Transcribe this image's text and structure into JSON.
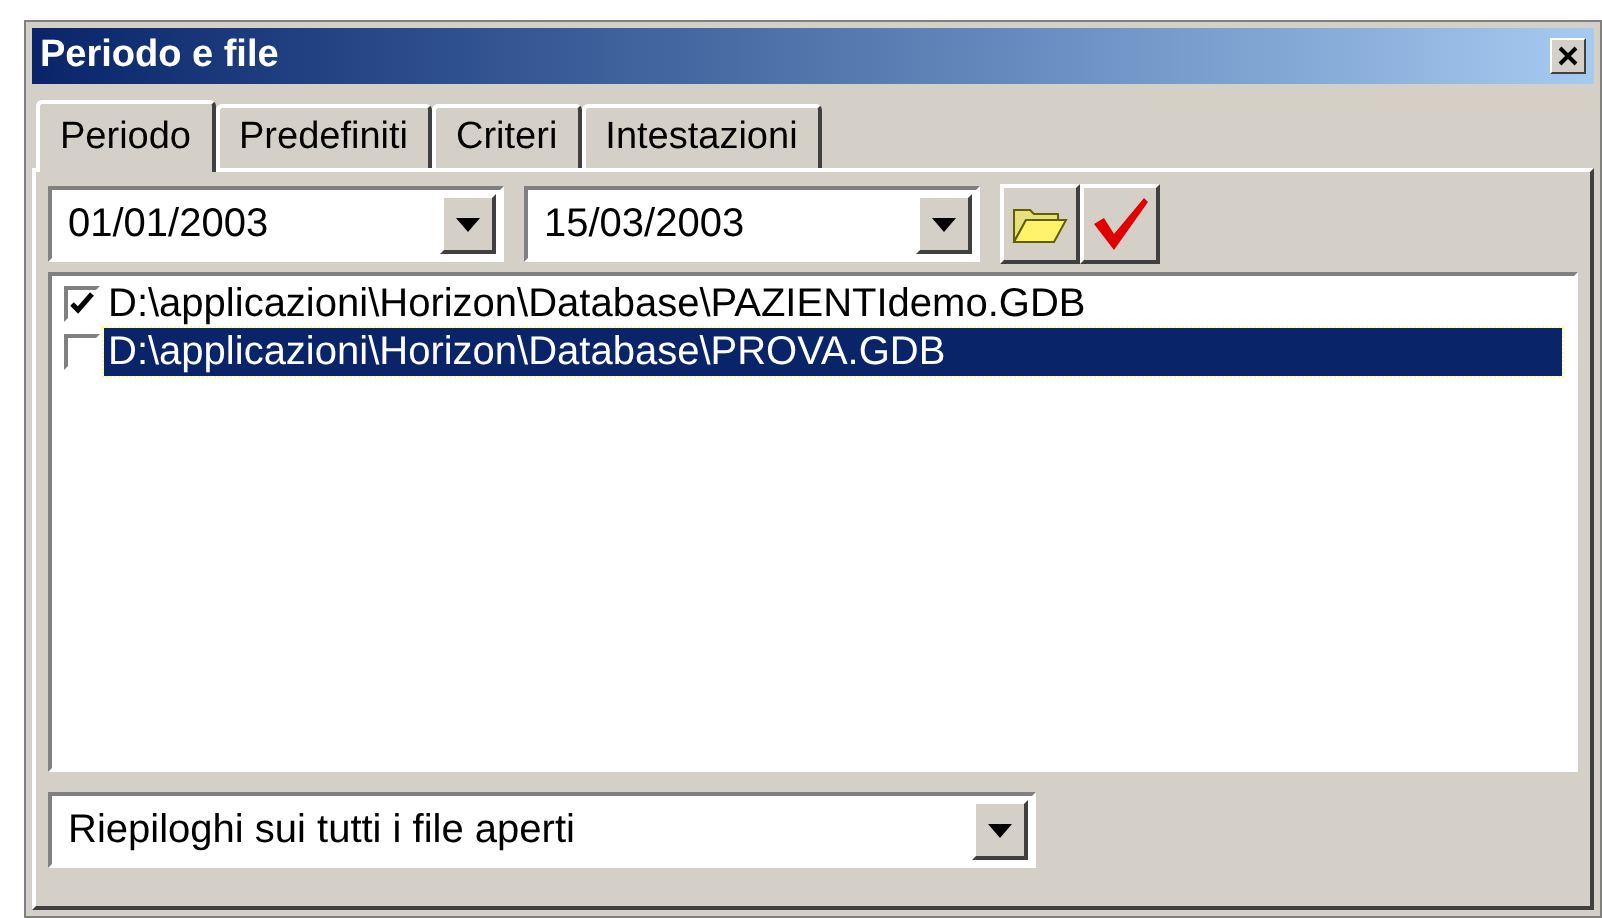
{
  "window": {
    "title": "Periodo e file"
  },
  "tabs": [
    {
      "label": "Periodo",
      "selected": true
    },
    {
      "label": "Predefiniti",
      "selected": false
    },
    {
      "label": "Criteri",
      "selected": false
    },
    {
      "label": "Intestazioni",
      "selected": false
    }
  ],
  "date_from": {
    "value": "01/01/2003"
  },
  "date_to": {
    "value": "15/03/2003"
  },
  "files": [
    {
      "path": "D:\\applicazioni\\Horizon\\Database\\PAZIENTIdemo.GDB",
      "checked": true,
      "selected": false
    },
    {
      "path": "D:\\applicazioni\\Horizon\\Database\\PROVA.GDB",
      "checked": false,
      "selected": true
    }
  ],
  "summary": {
    "value": "Riepiloghi sui tutti i file aperti"
  }
}
